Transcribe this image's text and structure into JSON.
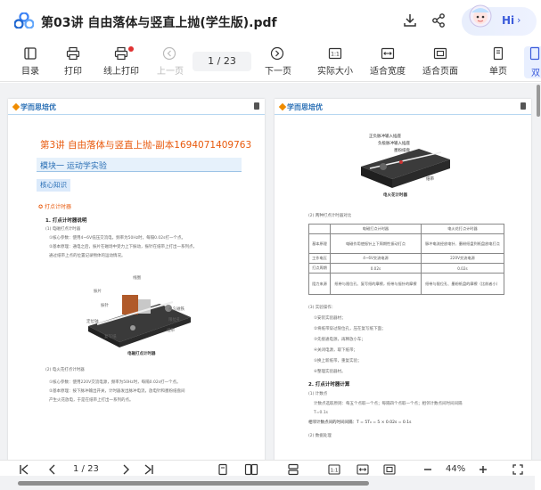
{
  "titlebar": {
    "title": "第03讲 自由落体与竖直上抛(学生版).pdf",
    "ai_button": {
      "label": "Hi"
    }
  },
  "toolbar": {
    "items": [
      {
        "label": "目录",
        "icon": "table-of-contents-icon"
      },
      {
        "label": "打印",
        "icon": "printer-icon"
      },
      {
        "label": "线上打印",
        "icon": "online-print-icon"
      },
      {
        "label": "上一页",
        "icon": "prev-page-icon",
        "disabled": true
      },
      {
        "label": "下一页",
        "icon": "next-page-icon"
      },
      {
        "label": "实际大小",
        "icon": "actual-size-icon"
      },
      {
        "label": "适合宽度",
        "icon": "fit-width-icon"
      },
      {
        "label": "适合页面",
        "icon": "fit-page-icon"
      },
      {
        "label": "单页",
        "icon": "single-page-icon"
      },
      {
        "label": "双",
        "icon": "double-page-icon"
      }
    ],
    "page_indicator": "1 / 23"
  },
  "document": {
    "header_logo": "学而思培优",
    "left_page": {
      "lesson_title": "第3讲 自由落体与竖直上抛-副本1694071409763",
      "module": "模块一  运动学实验",
      "core_tag": "核心知识",
      "section": "打点计时器",
      "sub1": "1. 打点计时器说明",
      "lines1": [
        "(1) 电磁打点计时器",
        "①核心参数：使用4~6V低压交流电，频率为50Hz时，每隔0.02s打一个点。",
        "②基本原理：通电之后，振片在磁场中受力上下振动，振针在纸带上打出一系列点，",
        "通过纸带上点的位置记录物体的运动情况。"
      ],
      "device_labels": [
        "线圈",
        "振片",
        "永久磁铁",
        "振针",
        "限位孔",
        "复写纸",
        "定位轴",
        "纸带",
        "电磁打点计时器"
      ],
      "lines2": [
        "(2) 电火花打点计时器",
        "①核心参数：使用220V交流电源，频率为50Hz时，每隔0.02s打一个点。",
        "②基本原理：按下脉冲输出开关，计时器发出脉冲电流，放电针和墨粉纸盘间",
        "产生火花放电，于是在纸带上打出一系列的点。"
      ]
    },
    "right_page": {
      "device_labels": [
        "正负脉冲输入插座",
        "负极脉冲输入插座",
        "墨粉纸盘",
        "纸带",
        "电火花计时器"
      ],
      "caption": "(2) 两种打点计时器对比",
      "table": {
        "headers": [
          "",
          "电磁打点计时器",
          "电火花打点计时器"
        ],
        "rows": [
          [
            "基本原理",
            "电磁作用使振针上下周期性振动打点",
            "脉冲电流经放电针、墨粉纸盘到纸盘放电打点"
          ],
          [
            "工作电压",
            "4~6V交流电源",
            "220V交流电源"
          ],
          [
            "打点周期",
            "0.02s",
            "0.02s"
          ],
          [
            "阻力来源",
            "纸带与限位孔、复写纸的摩擦，纸带与振针的摩擦",
            "纸带与限位孔、墨粉纸盘的摩擦（比前者小）"
          ]
        ]
      },
      "lines1": [
        "(3) 实验操作：",
        "①安装实验器材；",
        "②将纸带穿过限位孔，压在复写纸下面；",
        "③先接通电源，再释放小车；",
        "④关闭电源，取下纸带；",
        "⑤换上新纸带，重复实验；",
        "⑥整理实验器材。"
      ],
      "sub2": "2. 打点计时器计算",
      "lines2": [
        "(1) 计数点",
        "计数点选取原则：每五个点取一个点；每隔四个点取一个点；相邻计数点间时间间隔",
        "T=0.1s"
      ],
      "formula": "相邻计数点间的时间间隔：T = 5T₀ = 5 × 0.02s = 0.1s",
      "lines3": [
        "(2) 数据处理"
      ]
    }
  },
  "bottombar": {
    "page_indicator": "1 / 23",
    "zoom": "44%"
  },
  "colors": {
    "accent": "#2a6fb5",
    "lesson_title": "#e8590c",
    "ai_label": "#3b5bdb"
  }
}
